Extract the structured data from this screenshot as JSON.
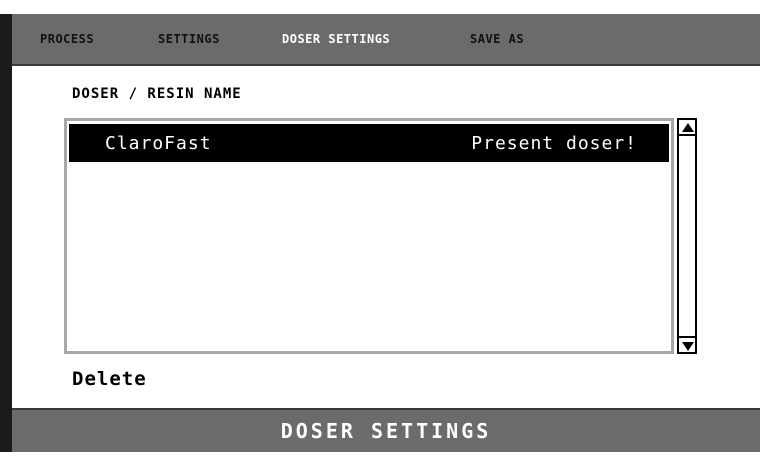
{
  "nav": {
    "items": [
      {
        "label": "PROCESS",
        "active": false
      },
      {
        "label": "SETTINGS",
        "active": false
      },
      {
        "label": "DOSER SETTINGS",
        "active": true
      },
      {
        "label": "SAVE AS",
        "active": false
      }
    ]
  },
  "main": {
    "section_title": "DOSER / RESIN NAME",
    "list": {
      "rows": [
        {
          "name": "ClaroFast",
          "status": "Present doser!",
          "selected": true
        }
      ],
      "scroll_up_icon": "arrow-up-icon",
      "scroll_down_icon": "arrow-down-icon"
    },
    "delete_label": "Delete"
  },
  "footer": {
    "title": "DOSER SETTINGS"
  },
  "colors": {
    "bar": "#6b6b6b",
    "selected_row": "#000000",
    "list_border": "#a8a8a8",
    "active_nav": "#ffffff"
  }
}
